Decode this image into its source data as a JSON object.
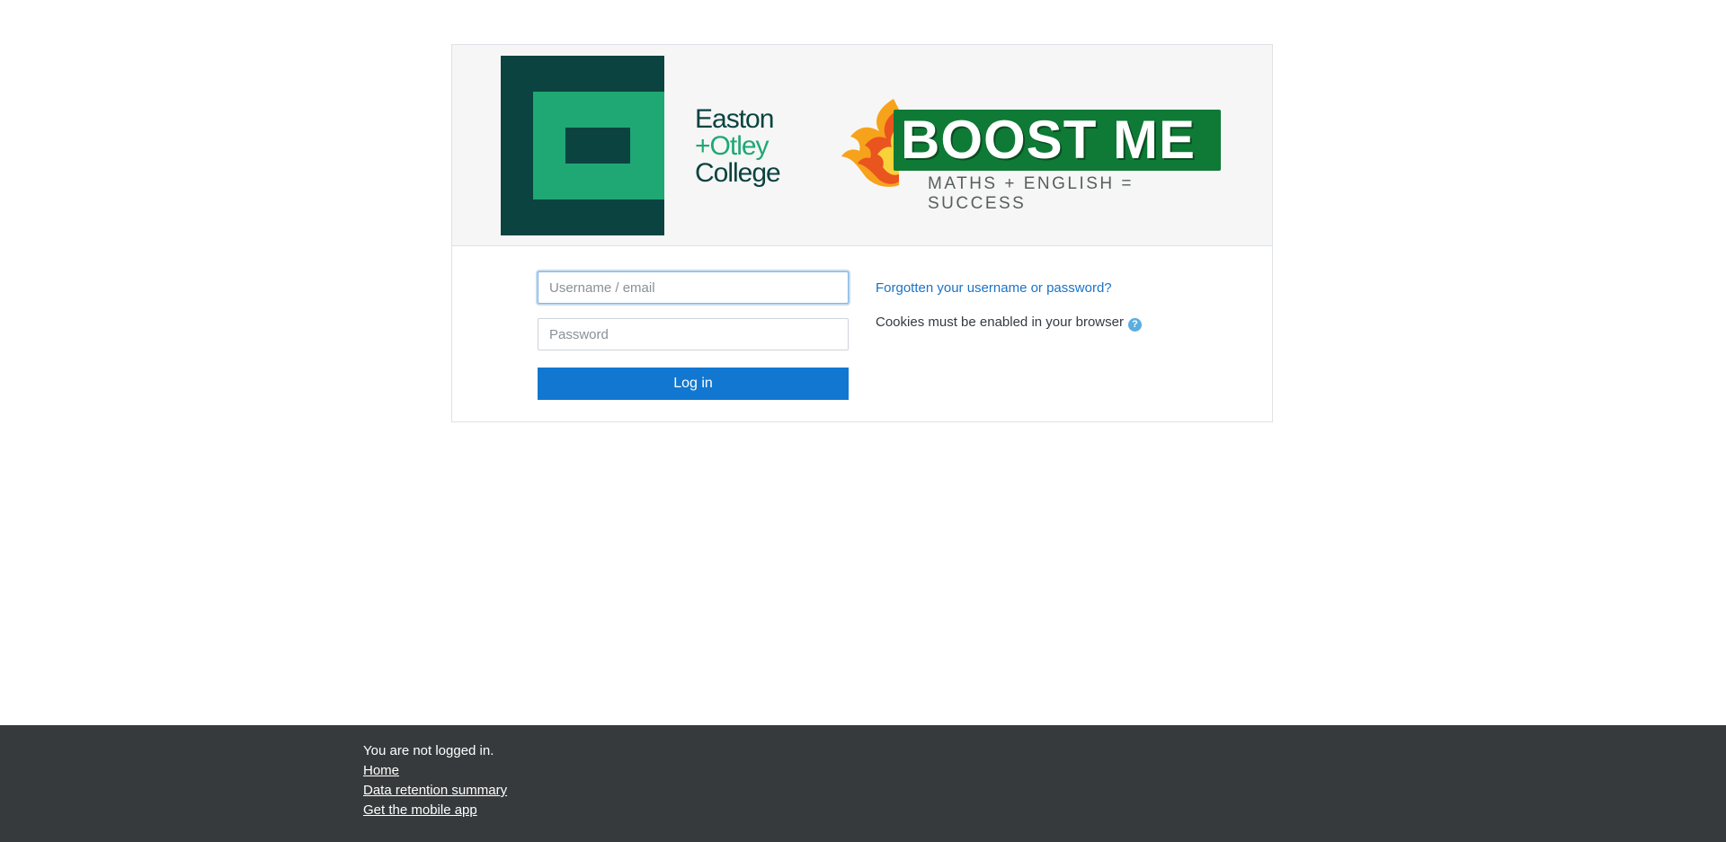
{
  "logos": {
    "college_name_line1": "Easton",
    "college_name_line2": "+Otley",
    "college_name_line3": "College",
    "boost_title": "BOOST ME",
    "boost_subtitle": "MATHS + ENGLISH = SUCCESS",
    "colors": {
      "college_dark": "#0b4340",
      "college_green": "#1fa874",
      "boost_green": "#0e7a35"
    }
  },
  "login": {
    "username_placeholder": "Username / email",
    "password_placeholder": "Password",
    "submit_label": "Log in",
    "forgot_link": "Forgotten your username or password?",
    "cookies_notice": "Cookies must be enabled in your browser",
    "help_icon": "question-circle-icon"
  },
  "footer": {
    "status": "You are not logged in.",
    "links": [
      {
        "label": "Home"
      },
      {
        "label": "Data retention summary"
      },
      {
        "label": "Get the mobile app"
      }
    ]
  },
  "colors": {
    "primary": "#1177d1",
    "link": "#1a73c9",
    "footer_bg": "#373a3c"
  }
}
